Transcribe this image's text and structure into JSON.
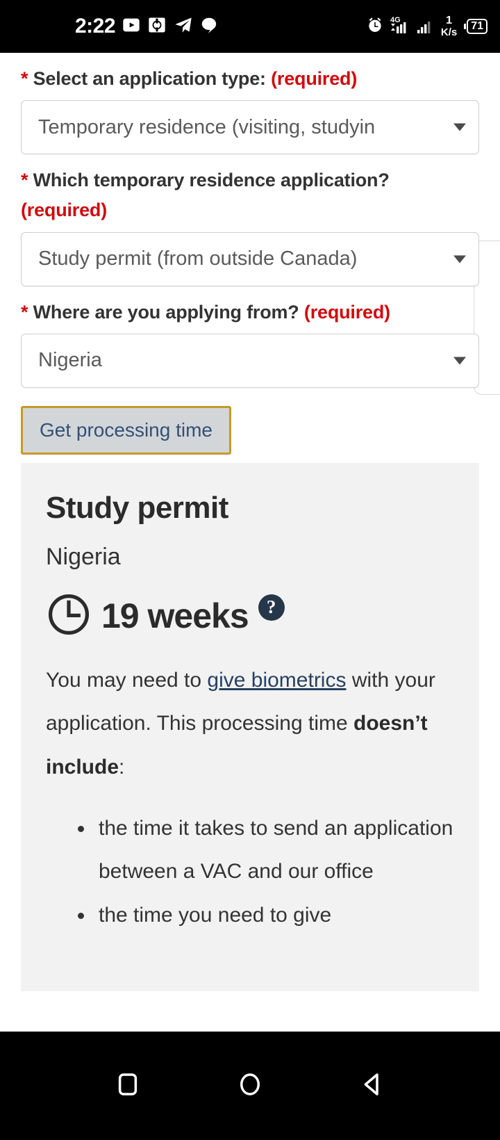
{
  "status_bar": {
    "time": "2:22",
    "left_icons": [
      "youtube-icon",
      "camera-icon",
      "telegram-icon",
      "chat-bubble-icon"
    ],
    "right_icons": [
      "alarm-icon",
      "signal-4g-icon",
      "signal-bars-icon"
    ],
    "network_label": "4G",
    "net_speed_value": "1",
    "net_speed_unit": "K/s",
    "battery_level": "71"
  },
  "form": {
    "fields": [
      {
        "label": "Select an application type:",
        "required_tag": "(required)",
        "star": "*",
        "value": "Temporary residence (visiting, studyin"
      },
      {
        "label": "Which temporary residence application?",
        "required_tag": "(required)",
        "star": "*",
        "value": "Study permit (from outside Canada)"
      },
      {
        "label": "Where are you applying from?",
        "required_tag": "(required)",
        "star": "*",
        "value": "Nigeria"
      }
    ],
    "submit_label": "Get processing time"
  },
  "result": {
    "title": "Study permit",
    "country": "Nigeria",
    "processing_time": "19 weeks",
    "help_glyph": "?",
    "paragraph": {
      "part1": "You may need to ",
      "link": "give biometrics",
      "part2": " with your application. This processing time ",
      "bold": "doesn’t include",
      "part3": ":"
    },
    "bullets": [
      "the time it takes to send an application between a VAC and our office",
      "the time you need to give"
    ]
  },
  "nav_bar": {
    "buttons": [
      "recents-square-icon",
      "home-circle-icon",
      "back-triangle-icon"
    ]
  }
}
